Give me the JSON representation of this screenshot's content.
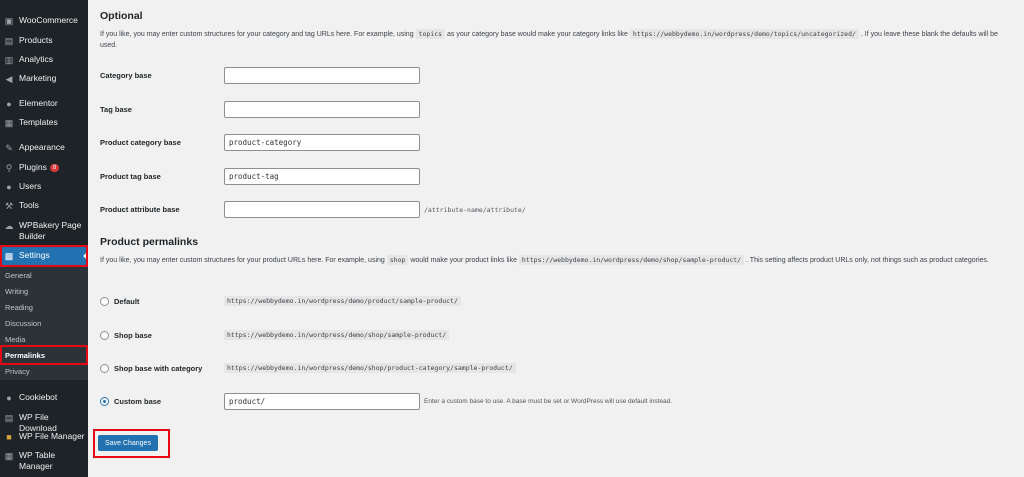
{
  "sidebar": {
    "items": [
      {
        "label": "WooCommerce",
        "icon": "woocommerce-icon"
      },
      {
        "label": "Products",
        "icon": "products-icon"
      },
      {
        "label": "Analytics",
        "icon": "analytics-icon"
      },
      {
        "label": "Marketing",
        "icon": "marketing-icon"
      },
      {
        "label": "Elementor",
        "icon": "elementor-icon"
      },
      {
        "label": "Templates",
        "icon": "templates-icon"
      },
      {
        "label": "Appearance",
        "icon": "appearance-icon"
      },
      {
        "label": "Plugins",
        "icon": "plugins-icon",
        "badge": "8"
      },
      {
        "label": "Users",
        "icon": "users-icon"
      },
      {
        "label": "Tools",
        "icon": "tools-icon"
      },
      {
        "label": "WPBakery Page Builder",
        "icon": "wpbakery-icon"
      },
      {
        "label": "Settings",
        "icon": "settings-icon"
      },
      {
        "label": "Cookiebot",
        "icon": "cookiebot-icon"
      },
      {
        "label": "WP File Download",
        "icon": "file-download-icon"
      },
      {
        "label": "WP File Manager",
        "icon": "file-manager-icon"
      },
      {
        "label": "WP Table Manager",
        "icon": "table-manager-icon"
      }
    ],
    "submenu": [
      "General",
      "Writing",
      "Reading",
      "Discussion",
      "Media",
      "Permalinks",
      "Privacy"
    ]
  },
  "optional": {
    "heading": "Optional",
    "desc_1": "If you like, you may enter custom structures for your category and tag URLs here. For example, using",
    "code_1": "topics",
    "desc_2": "as your category base would make your category links like",
    "code_2": "https://webbydemo.in/wordpress/demo/topics/uncategorized/",
    "desc_3": ". If you leave these blank the",
    "desc_4": "defaults will be used."
  },
  "fields": {
    "category_base": {
      "label": "Category base",
      "value": ""
    },
    "tag_base": {
      "label": "Tag base",
      "value": ""
    },
    "product_category_base": {
      "label": "Product category base",
      "value": "product-category"
    },
    "product_tag_base": {
      "label": "Product tag base",
      "value": "product-tag"
    },
    "product_attribute_base": {
      "label": "Product attribute base",
      "value": "",
      "suffix": "/attribute-name/attribute/"
    }
  },
  "product_permalinks": {
    "heading": "Product permalinks",
    "desc_1": "If you like, you may enter custom structures for your product URLs here. For example, using",
    "code_1": "shop",
    "desc_2": "would make your product links like",
    "code_2": "https://webbydemo.in/wordpress/demo/shop/sample-product/",
    "desc_3": ". This setting affects product URLs only, not things such as product",
    "desc_4": "categories.",
    "options": [
      {
        "label": "Default",
        "url": "https://webbydemo.in/wordpress/demo/product/sample-product/",
        "checked": false
      },
      {
        "label": "Shop base",
        "url": "https://webbydemo.in/wordpress/demo/shop/sample-product/",
        "checked": false
      },
      {
        "label": "Shop base with category",
        "url": "https://webbydemo.in/wordpress/demo/shop/product-category/sample-product/",
        "checked": false
      },
      {
        "label": "Custom base",
        "value": "product/",
        "hint": "Enter a custom base to use. A base must be set or WordPress will use default instead.",
        "checked": true
      }
    ]
  },
  "save_label": "Save Changes",
  "colors": {
    "sidebar_bg": "#1d2327",
    "accent": "#2271b1",
    "highlight": "#e50914",
    "badge": "#d63638"
  }
}
